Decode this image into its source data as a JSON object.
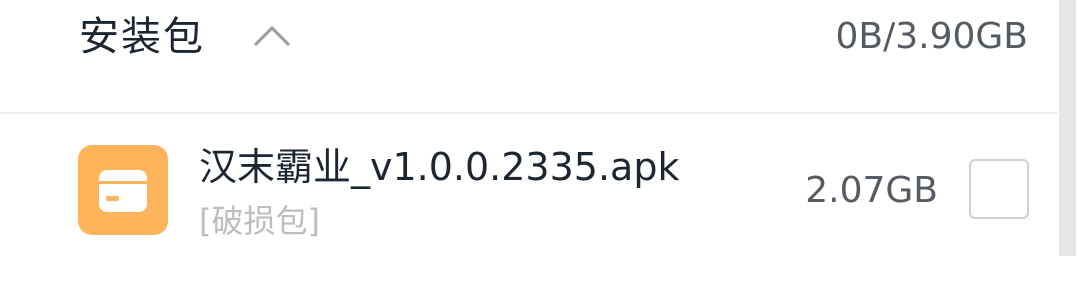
{
  "section": {
    "title": "安装包",
    "total": "0B/3.90GB",
    "toggle_icon": "chevron-up-icon"
  },
  "files": [
    {
      "name": "汉末霸业_v1.0.0.2335.apk",
      "status": "[破损包]",
      "size": "2.07GB",
      "icon": "package-icon",
      "icon_color": "#fdb35a",
      "selected": false
    }
  ],
  "colors": {
    "title_text": "#1c2530",
    "secondary_text": "#555b62",
    "muted_text": "#bdbdbd",
    "divider": "#eeeeee",
    "scrollbar_thumb": "#e6e6e6"
  }
}
